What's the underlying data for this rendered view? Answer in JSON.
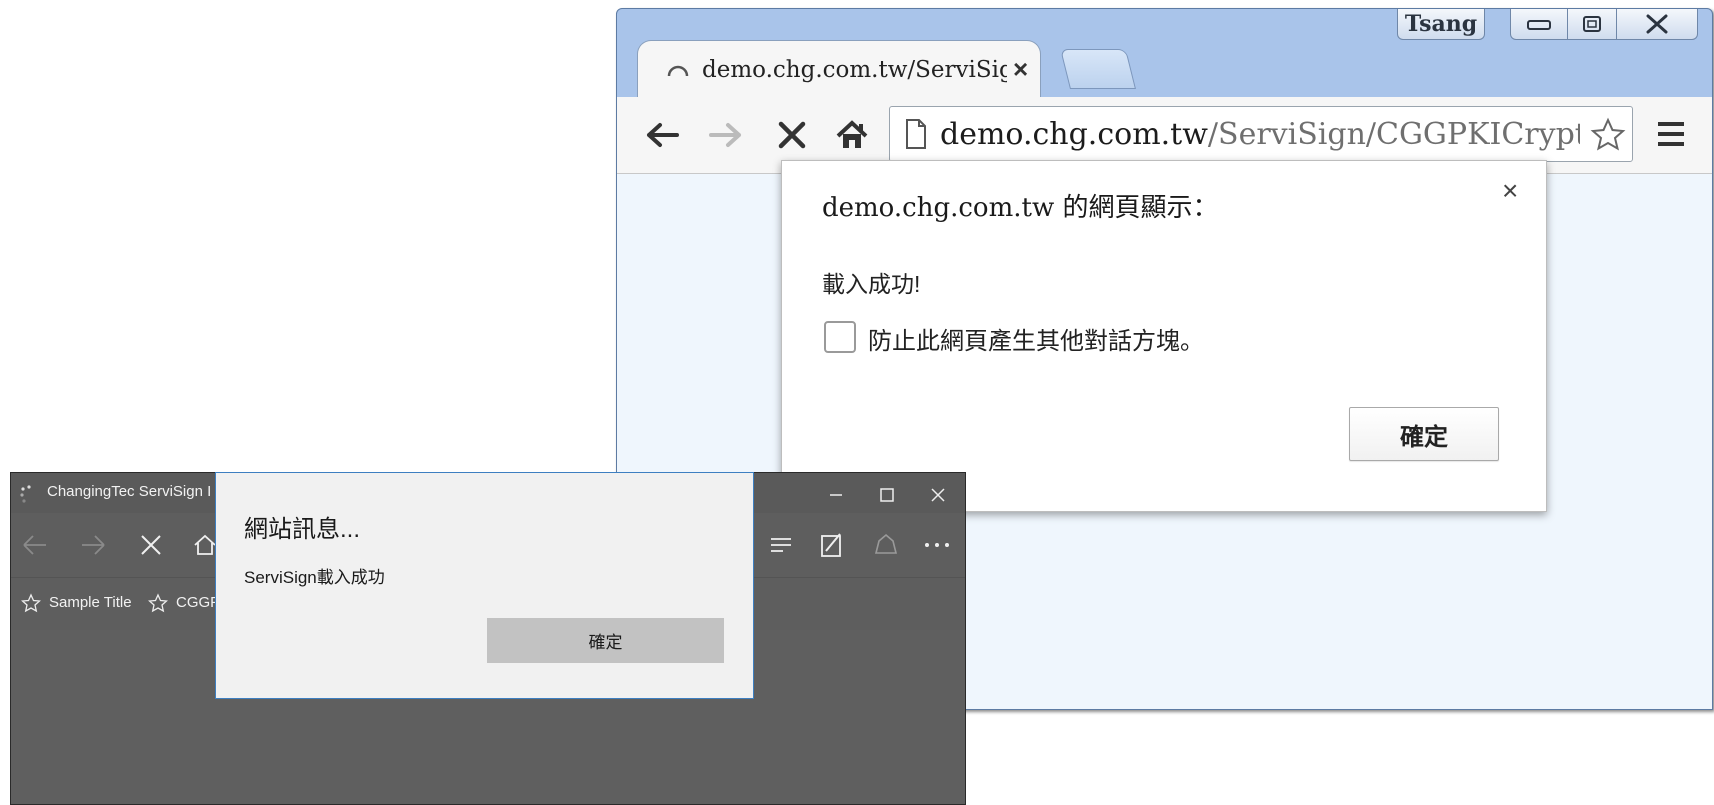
{
  "chrome_window": {
    "profile_name": "Tsang",
    "tab": {
      "title": "demo.chg.com.tw/ServiSign/CGGPKICryptATL",
      "close_glyph": "×",
      "loading_icon": "loading-spinner-icon"
    },
    "omnibox": {
      "url_host": "demo.chg.com.tw",
      "url_path": "/ServiSign/CGGPKICryptATL."
    },
    "toolbar_icons": [
      "back-arrow-icon",
      "forward-arrow-icon",
      "stop-icon",
      "home-icon",
      "page-icon",
      "star-icon",
      "menu-icon"
    ],
    "window_controls": [
      "minimize-icon",
      "restore-icon",
      "close-icon"
    ],
    "alert": {
      "title": "demo.chg.com.tw 的網頁顯示：",
      "close_glyph": "×",
      "message": "載入成功!",
      "checkbox_label": "防止此網頁產生其他對話方塊。",
      "checkbox_checked": false,
      "ok_label": "確定"
    }
  },
  "edge_window": {
    "tab_title": "ChangingTec ServiSign I",
    "favorites": [
      "Sample Title",
      "CGGPK"
    ],
    "toolbar_icons": [
      "back-arrow-icon",
      "forward-arrow-icon",
      "stop-icon",
      "home-icon",
      "hub-icon",
      "note-icon",
      "share-icon",
      "more-icon"
    ],
    "window_controls": [
      "minimize-icon",
      "maximize-icon",
      "close-icon"
    ],
    "dialog": {
      "title": "網站訊息...",
      "message": "ServiSign載入成功",
      "ok_label": "確定"
    }
  },
  "colors": {
    "chrome_frame": "#a9c4ea",
    "chrome_content": "#eff6fd",
    "edge_dark": "#5f5f5f",
    "edge_dialog_border": "#3d7fc1"
  }
}
